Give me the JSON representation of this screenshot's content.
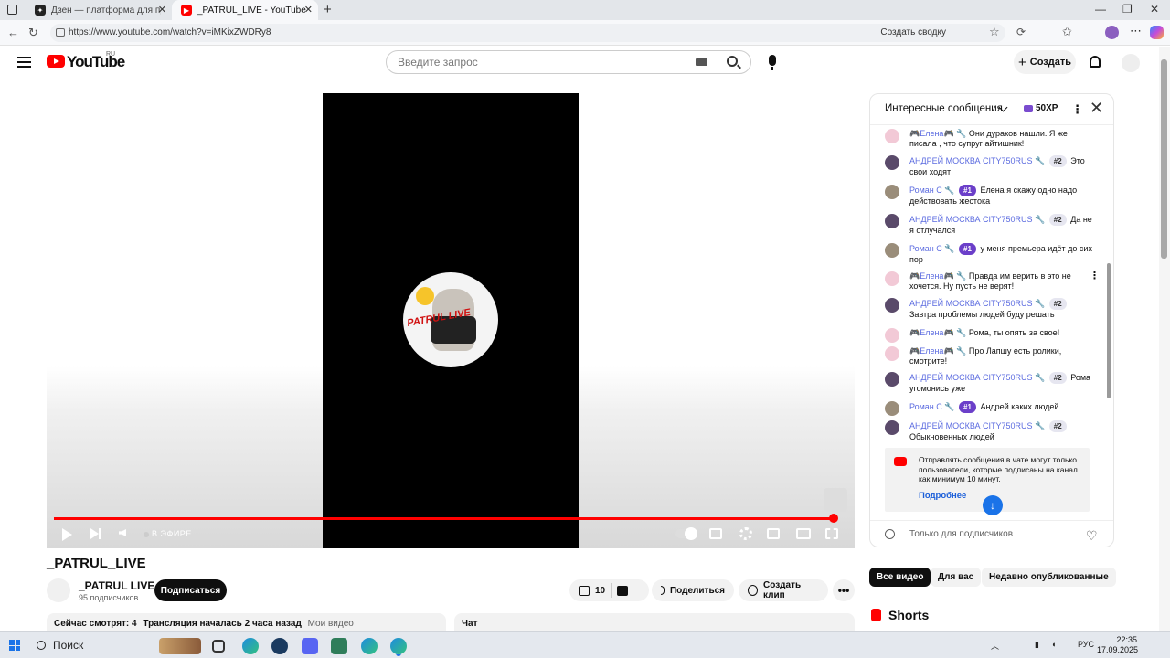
{
  "browser": {
    "tabs": [
      {
        "title": "Дзен — платформа для просмо",
        "active": false
      },
      {
        "title": "_PATRUL_LIVE - YouTube",
        "active": true
      }
    ],
    "url": "https://www.youtube.com/watch?v=iMKixZWDRy8",
    "summary_label": "Создать сводку"
  },
  "header": {
    "logo": "YouTube",
    "country": "RU",
    "search_placeholder": "Введите запрос",
    "create_label": "Создать"
  },
  "player": {
    "live_label": "В ЭФИРЕ",
    "overlay_text": "PATRUL LIVE"
  },
  "video": {
    "title": "_PATRUL_LIVE",
    "channel_name": "_PATRUL LIVE",
    "subscribers": "95 подписчиков",
    "subscribe_label": "Подписаться",
    "likes": "10",
    "share_label": "Поделиться",
    "clip_label": "Создать клип",
    "more_label": "•••",
    "watching": "Сейчас смотрят: 4",
    "started": "Трансляция началась 2 часа назад",
    "my_videos": "Мои видео",
    "chat_label": "Чат"
  },
  "chat": {
    "title": "Интересные сообщения",
    "xp": "50XP",
    "messages": [
      {
        "author": "🎮Елена🎮",
        "badge": "",
        "text": "Они дураков нашли. Я же писала , что супруг айтишник!"
      },
      {
        "author": "АНДРЕЙ МОСКВА CITY750RUS",
        "badge": "#2",
        "text": "Это свои ходят"
      },
      {
        "author": "Роман С",
        "badge": "#1",
        "text": "Елена я скажу одно надо действовать жестока"
      },
      {
        "author": "АНДРЕЙ МОСКВА CITY750RUS",
        "badge": "#2",
        "text": "Да не я отлучался"
      },
      {
        "author": "Роман С",
        "badge": "#1",
        "text": "у меня премьера идёт до сих пор"
      },
      {
        "author": "🎮Елена🎮",
        "badge": "",
        "text": "Правда им верить в это не хочется. Ну пусть не верят!"
      },
      {
        "author": "АНДРЕЙ МОСКВА CITY750RUS",
        "badge": "#2",
        "text": "Завтра проблемы людей буду решать"
      },
      {
        "author": "🎮Елена🎮",
        "badge": "",
        "text": "Рома, ты опять за свое!"
      },
      {
        "author": "🎮Елена🎮",
        "badge": "",
        "text": "Про Лапшу есть ролики, смотрите!"
      },
      {
        "author": "АНДРЕЙ МОСКВА CITY750RUS",
        "badge": "#2",
        "text": "Рома угомонись уже"
      },
      {
        "author": "Роман С",
        "badge": "#1",
        "text": "Андрей каких людей"
      },
      {
        "author": "АНДРЕЙ МОСКВА CITY750RUS",
        "badge": "#2",
        "text": "Обыкновенных людей"
      }
    ],
    "notice_text": "Отправлять сообщения в чате могут только пользователи, которые подписаны на канал как минимум 10 минут.",
    "notice_link": "Подробнее",
    "input_placeholder": "Только для подписчиков"
  },
  "chips": [
    "Все видео",
    "Для вас",
    "Недавно опубликованные"
  ],
  "shorts_label": "Shorts",
  "taskbar": {
    "search_label": "Поиск",
    "lang": "РУС",
    "time": "22:35",
    "date": "17.09.2025"
  },
  "colors": {
    "yt_red": "#ff0000",
    "chat_author": "#5b6be0",
    "badge_purple": "#6b3fc9",
    "link_blue": "#1a5ed9"
  }
}
